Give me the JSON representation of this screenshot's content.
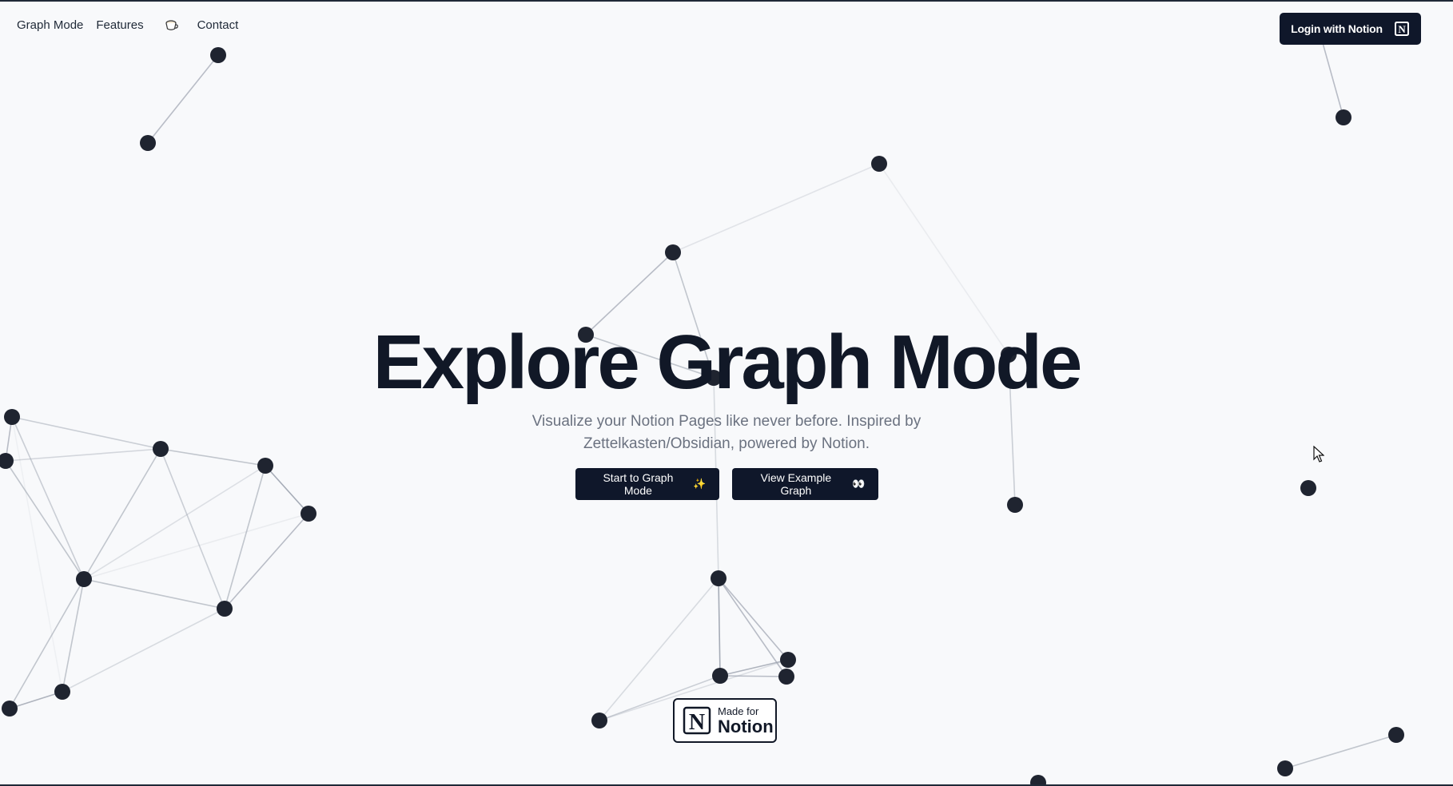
{
  "nav": {
    "items": [
      {
        "label": "Graph Mode"
      },
      {
        "label": "Features"
      },
      {
        "label": "Contact"
      }
    ]
  },
  "login_button": {
    "label": "Login with Notion"
  },
  "hero": {
    "title": "Explore Graph Mode",
    "subtitle": "Visualize your Notion Pages like never before. Inspired by Zettelkasten/Obsidian, powered by Notion."
  },
  "cta": {
    "primary_label": "Start to Graph Mode",
    "primary_emoji": "✨",
    "secondary_label": "View Example Graph",
    "secondary_emoji": "👀"
  },
  "badge": {
    "line1": "Made for",
    "line2": "Notion"
  },
  "colors": {
    "background": "#f8f9fb",
    "dark": "#0f172a",
    "node": "#1f2430",
    "subtitle": "#6b7280"
  }
}
